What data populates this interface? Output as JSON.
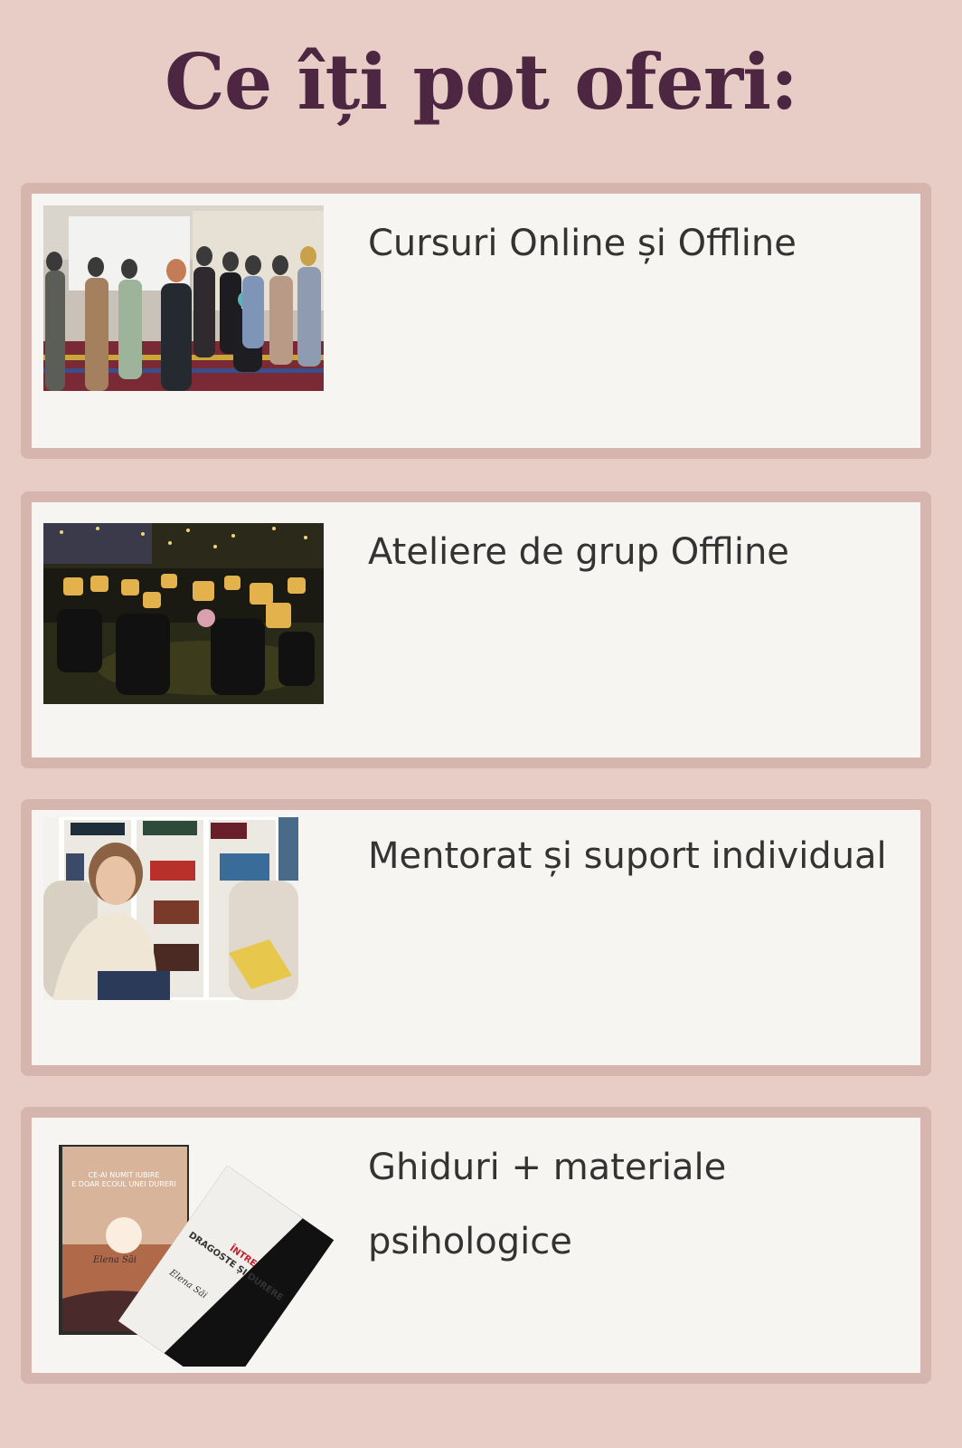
{
  "page": {
    "title": "Ce îți pot oferi:"
  },
  "offers": [
    {
      "title": "Cursuri Online și Offline",
      "image": "group-photo"
    },
    {
      "title": "Ateliere de grup Offline",
      "image": "workshop-room"
    },
    {
      "title": "Mentorat și suport individual",
      "image": "mentor-portrait"
    },
    {
      "title": "Ghiduri + materiale psihologice",
      "image": "books"
    }
  ],
  "books": {
    "book1": {
      "title": "CE-AI NUMIT IUBIRE E DOAR ECOUL UNEI DURERI",
      "author": "Elena Săi"
    },
    "book2": {
      "title": "ÎNTRE DRAGOSTE ȘI DURERE",
      "author": "Elena Săi"
    }
  },
  "colors": {
    "background": "#e8ccc6",
    "card_border": "#d5b5ad",
    "card_fill": "#f7f5f1",
    "title": "#4d2642",
    "text": "#333333"
  }
}
